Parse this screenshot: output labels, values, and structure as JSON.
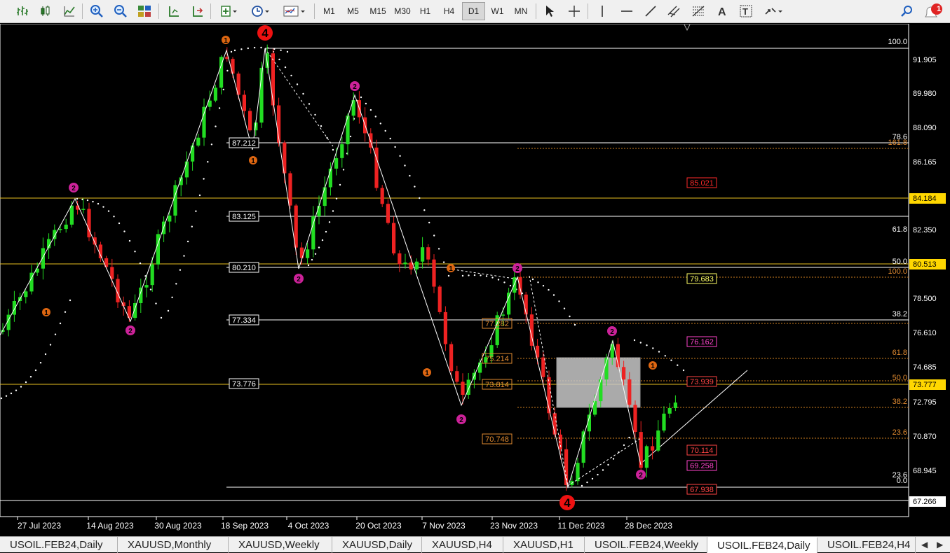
{
  "toolbar": {
    "timeframes": [
      "M1",
      "M5",
      "M15",
      "M30",
      "H1",
      "H4",
      "D1",
      "W1",
      "MN"
    ],
    "active_timeframe": "D1",
    "notification_count": "1"
  },
  "chart": {
    "symbol_tab": "USOIL.FEB24,Daily",
    "price_axis": [
      "91.905",
      "89.980",
      "88.090",
      "86.165",
      "84.184",
      "82.350",
      "80.513",
      "78.500",
      "76.610",
      "74.685",
      "73.777",
      "72.795",
      "70.870",
      "68.945",
      "67.266"
    ],
    "highlighted_prices": [
      {
        "label": "84.184",
        "style": "yellow"
      },
      {
        "label": "80.513",
        "style": "yellow"
      },
      {
        "label": "73.777",
        "style": "yellow"
      },
      {
        "label": "67.266",
        "style": "white"
      }
    ],
    "date_axis": [
      "27 Jul 2023",
      "14 Aug 2023",
      "30 Aug 2023",
      "18 Sep 2023",
      "4 Oct 2023",
      "20 Oct 2023",
      "7 Nov 2023",
      "23 Nov 2023",
      "11 Dec 2023",
      "28 Dec 2023"
    ],
    "left_level_labels": [
      "87.212",
      "83.125",
      "80.210",
      "77.334",
      "73.776"
    ],
    "fib_right_labels": [
      "100.0",
      "78.6",
      "61.8",
      "50.0",
      "38.2",
      "23.6",
      "0.0"
    ],
    "fib_secondary_labels": [
      "100.0",
      "61.8",
      "50.0",
      "38.2",
      "23.6",
      "161.8"
    ],
    "boxed_target_labels": [
      {
        "label": "85.021",
        "color": "#ff2a2a"
      },
      {
        "label": "79.683",
        "color": "#ffff66"
      },
      {
        "label": "76.162",
        "color": "#ff44cc"
      },
      {
        "label": "73.939",
        "color": "#ff4444"
      },
      {
        "label": "70.114",
        "color": "#ff4444"
      },
      {
        "label": "69.258",
        "color": "#ff44cc"
      },
      {
        "label": "67.938",
        "color": "#ff4444"
      }
    ],
    "mid_orange_labels": [
      "77.282",
      "75.214",
      "73.814",
      "70.748"
    ],
    "wave_labels": [
      "1",
      "2",
      "4"
    ],
    "colors": {
      "bull": "#22dd22",
      "bear": "#ee2222",
      "zigzag": "#ffffff",
      "level_yellow": "#e8c020",
      "wave2": "#cc2299",
      "wave1": "#dd6611",
      "wave4": "#ee1111"
    }
  },
  "tabs": {
    "items": [
      "USOIL.FEB24,Daily",
      "XAUUSD,Monthly",
      "XAUUSD,Weekly",
      "XAUUSD,Daily",
      "XAUUSD,H4",
      "XAUUSD,H1",
      "USOIL.FEB24,Weekly",
      "USOIL.FEB24,Daily",
      "USOIL.FEB24,H4"
    ],
    "active_index": 7
  }
}
